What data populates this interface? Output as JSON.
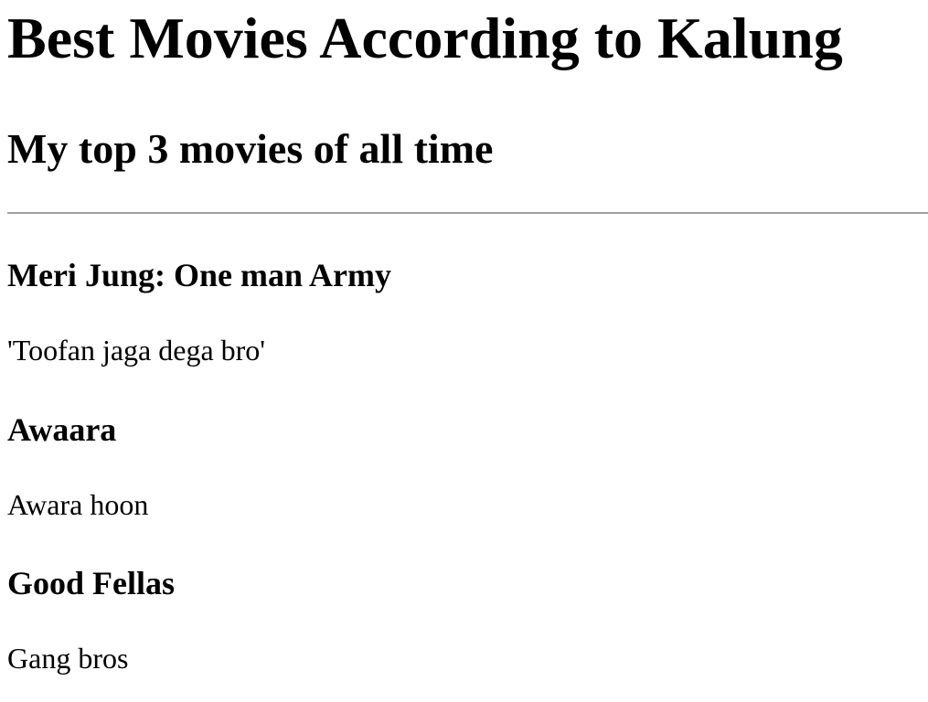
{
  "page": {
    "title": "Best Movies According to Kalung",
    "subtitle": "My top 3 movies of all time"
  },
  "movies": [
    {
      "title": "Meri Jung: One man Army",
      "description": "'Toofan jaga dega bro'"
    },
    {
      "title": "Awaara",
      "description": "Awara hoon"
    },
    {
      "title": "Good Fellas",
      "description": "Gang bros"
    }
  ]
}
